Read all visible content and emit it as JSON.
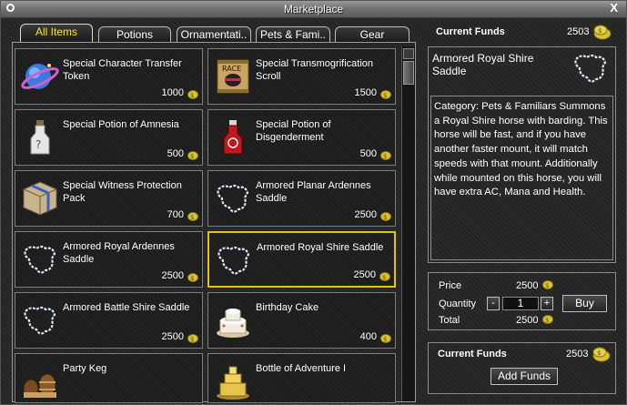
{
  "window": {
    "title": "Marketplace"
  },
  "tabs": [
    {
      "label": "All Items"
    },
    {
      "label": "Potions"
    },
    {
      "label": "Ornamentati.."
    },
    {
      "label": "Pets & Fami.."
    },
    {
      "label": "Gear"
    }
  ],
  "items": [
    {
      "name": "Special Character Transfer Token",
      "price": "1000",
      "icon": "planet-token-icon"
    },
    {
      "name": "Special Transmogrification Scroll",
      "price": "1500",
      "icon": "race-scroll-icon"
    },
    {
      "name": "Special Potion of Amnesia",
      "price": "500",
      "icon": "white-potion-icon"
    },
    {
      "name": "Special Potion of Disgenderment",
      "price": "500",
      "icon": "red-potion-icon"
    },
    {
      "name": "Special Witness Protection Pack",
      "price": "700",
      "icon": "package-icon"
    },
    {
      "name": "Armored Planar Ardennes Saddle",
      "price": "2500",
      "icon": "saddle-icon"
    },
    {
      "name": "Armored Royal Ardennes Saddle",
      "price": "2500",
      "icon": "saddle-icon"
    },
    {
      "name": "Armored Royal Shire Saddle",
      "price": "2500",
      "icon": "saddle-icon"
    },
    {
      "name": "Armored Battle Shire Saddle",
      "price": "2500",
      "icon": "saddle-icon"
    },
    {
      "name": "Birthday Cake",
      "price": "400",
      "icon": "cake-icon"
    },
    {
      "name": "Party Keg",
      "price": "",
      "icon": "keg-icon"
    },
    {
      "name": "Bottle of Adventure I",
      "price": "",
      "icon": "golden-cake-icon"
    }
  ],
  "funds_top": {
    "label": "Current Funds",
    "value": "2503"
  },
  "detail": {
    "title": "Armored Royal Shire Saddle",
    "description": "Category: Pets & Familiars Summons a Royal Shire horse with barding. This horse will be fast, and if you have another faster mount, it will match speeds with that mount. Additionally while mounted on this horse, you will have extra AC, Mana and Health."
  },
  "purchase": {
    "price_label": "Price",
    "price": "2500",
    "quantity_label": "Quantity",
    "quantity": "1",
    "minus": "-",
    "plus": "+",
    "total_label": "Total",
    "total": "2500",
    "buy_label": "Buy"
  },
  "funds_bottom": {
    "label": "Current Funds",
    "value": "2503",
    "add_label": "Add Funds"
  },
  "colors": {
    "selected_border": "#e6c200",
    "active_tab_text": "#ffe600",
    "coin": "#d8c23a"
  }
}
